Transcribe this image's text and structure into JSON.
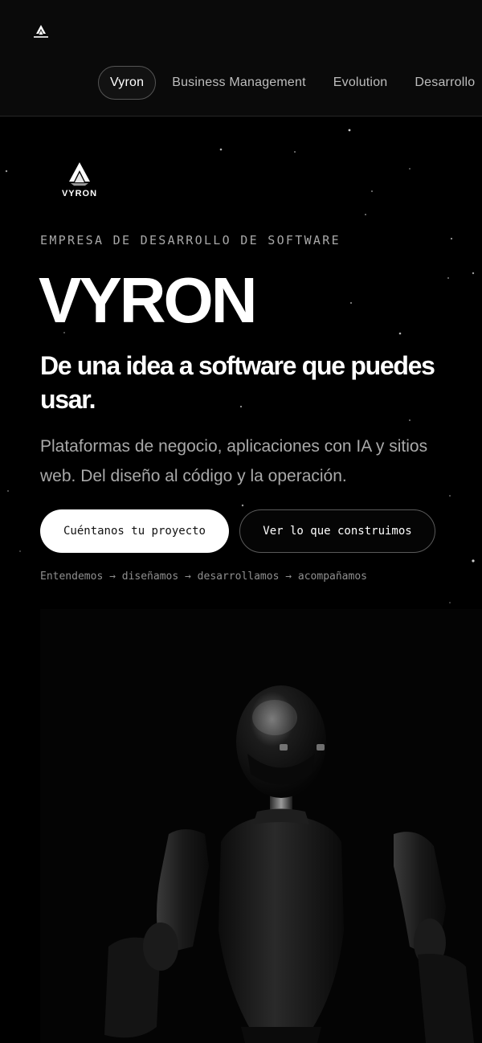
{
  "header": {
    "logo_icon": "vyron-logo-icon",
    "nav": [
      {
        "label": "Vyron",
        "active": true
      },
      {
        "label": "Business Management",
        "active": false
      },
      {
        "label": "Evolution",
        "active": false
      },
      {
        "label": "Desarrollo",
        "active": false
      }
    ]
  },
  "hero": {
    "logo_text": "VYRON",
    "eyebrow": "EMPRESA DE DESARROLLO DE SOFTWARE",
    "title": "VYRON",
    "subtitle": "De una idea a software que puedes usar.",
    "description": "Plataformas de negocio, aplicaciones con IA y sitios web. Del diseño al código y la operación.",
    "primary_cta": "Cuéntanos tu proyecto",
    "secondary_cta": "Ver lo que construimos",
    "process": "Entendemos → diseñamos → desarrollamos → acompañamos",
    "image": "humanoid-robot-illustration"
  },
  "colors": {
    "background": "#000000",
    "text": "#ffffff",
    "muted": "#a9a9a9"
  }
}
